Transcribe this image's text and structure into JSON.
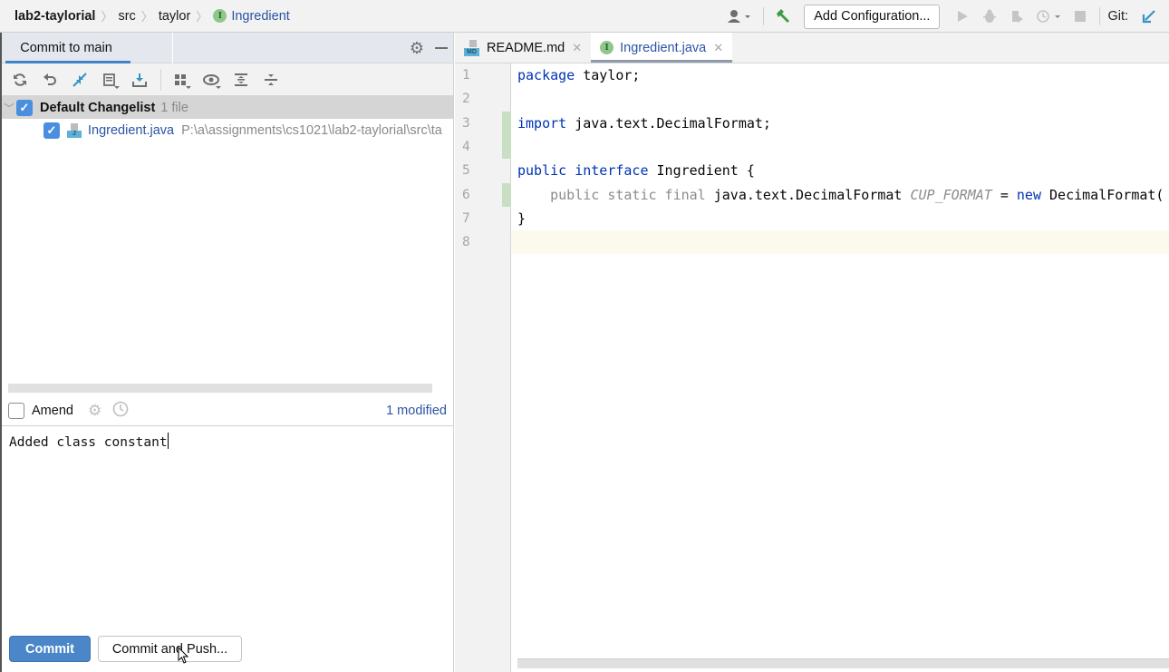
{
  "breadcrumb": {
    "project": "lab2-taylorial",
    "items": [
      "src",
      "taylor"
    ],
    "current": "Ingredient",
    "current_badge": "I"
  },
  "toolbar": {
    "add_configuration": "Add Configuration...",
    "git_label": "Git:"
  },
  "commit_panel": {
    "tab_label": "Commit to main",
    "changelist": {
      "name": "Default Changelist",
      "count": "1 file",
      "checked": true,
      "files": [
        {
          "name": "Ingredient.java",
          "path": "P:\\a\\assignments\\cs1021\\lab2-taylorial\\src\\ta",
          "checked": true,
          "icon_label": "J"
        }
      ]
    },
    "amend_label": "Amend",
    "amend_checked": false,
    "modified_summary": "1 modified",
    "message": "Added class constant",
    "commit_button": "Commit",
    "commit_push_button": "Commit and Push..."
  },
  "editor": {
    "tabs": [
      {
        "label": "README.md",
        "icon": "MD",
        "active": false
      },
      {
        "label": "Ingredient.java",
        "icon": "I",
        "active": true
      }
    ],
    "lines": [
      {
        "num": "1",
        "tokens": [
          {
            "t": "package",
            "c": "kw"
          },
          {
            "t": " taylor;",
            "c": "plain"
          }
        ]
      },
      {
        "num": "2",
        "tokens": []
      },
      {
        "num": "3",
        "tokens": [
          {
            "t": "import",
            "c": "kw"
          },
          {
            "t": " java.text.DecimalFormat;",
            "c": "plain"
          }
        ]
      },
      {
        "num": "4",
        "tokens": []
      },
      {
        "num": "5",
        "tokens": [
          {
            "t": "public",
            "c": "kw"
          },
          {
            "t": " ",
            "c": "plain"
          },
          {
            "t": "interface",
            "c": "kw"
          },
          {
            "t": " Ingredient {",
            "c": "plain"
          }
        ]
      },
      {
        "num": "6",
        "tokens": [
          {
            "t": "    public static final",
            "c": "mod"
          },
          {
            "t": " java.text.DecimalFormat ",
            "c": "plain"
          },
          {
            "t": "CUP_FORMAT",
            "c": "const"
          },
          {
            "t": " = ",
            "c": "plain"
          },
          {
            "t": "new",
            "c": "kw"
          },
          {
            "t": " DecimalFormat(",
            "c": "plain"
          }
        ]
      },
      {
        "num": "7",
        "tokens": [
          {
            "t": "}",
            "c": "plain"
          }
        ]
      },
      {
        "num": "8",
        "tokens": [],
        "current": true
      }
    ],
    "changed_lines": [
      3,
      4,
      6
    ]
  }
}
